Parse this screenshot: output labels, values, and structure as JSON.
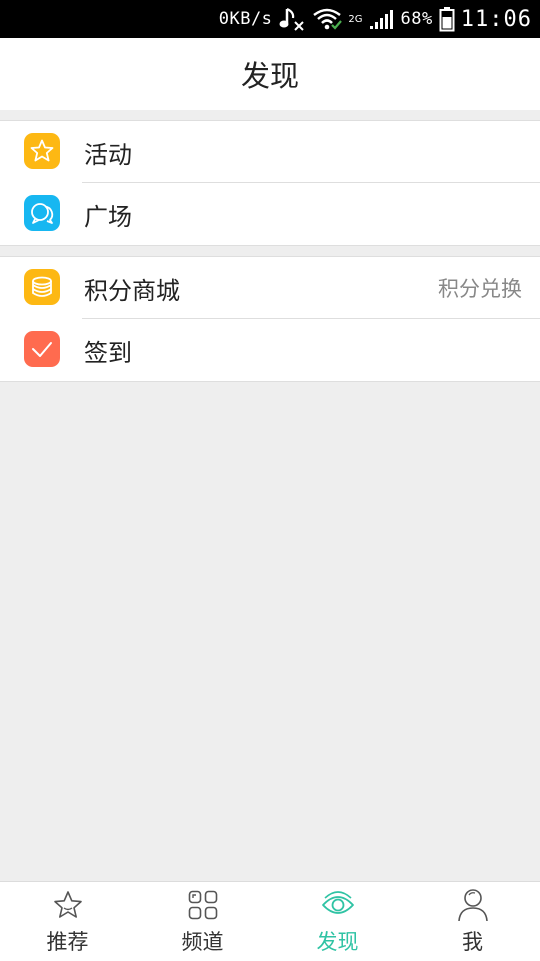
{
  "status_bar": {
    "speed": "0KB/s",
    "network_type": "2G",
    "battery": "68%",
    "time": "11:06"
  },
  "header": {
    "title": "发现"
  },
  "groups": [
    {
      "items": [
        {
          "label": "活动",
          "icon": "star-icon",
          "color": "#FDB813"
        },
        {
          "label": "广场",
          "icon": "chat-bubbles-icon",
          "color": "#17B7F1"
        }
      ]
    },
    {
      "items": [
        {
          "label": "积分商城",
          "icon": "coins-icon",
          "color": "#FDB813",
          "right_text": "积分兑换"
        },
        {
          "label": "签到",
          "icon": "checkmark-icon",
          "color": "#FF6B4F"
        }
      ]
    }
  ],
  "tabbar": {
    "active_color": "#2fc3a4",
    "tabs": [
      {
        "label": "推荐",
        "icon": "star-outline-icon"
      },
      {
        "label": "频道",
        "icon": "grid-icon"
      },
      {
        "label": "发现",
        "icon": "eye-icon",
        "active": true
      },
      {
        "label": "我",
        "icon": "person-icon"
      }
    ]
  }
}
